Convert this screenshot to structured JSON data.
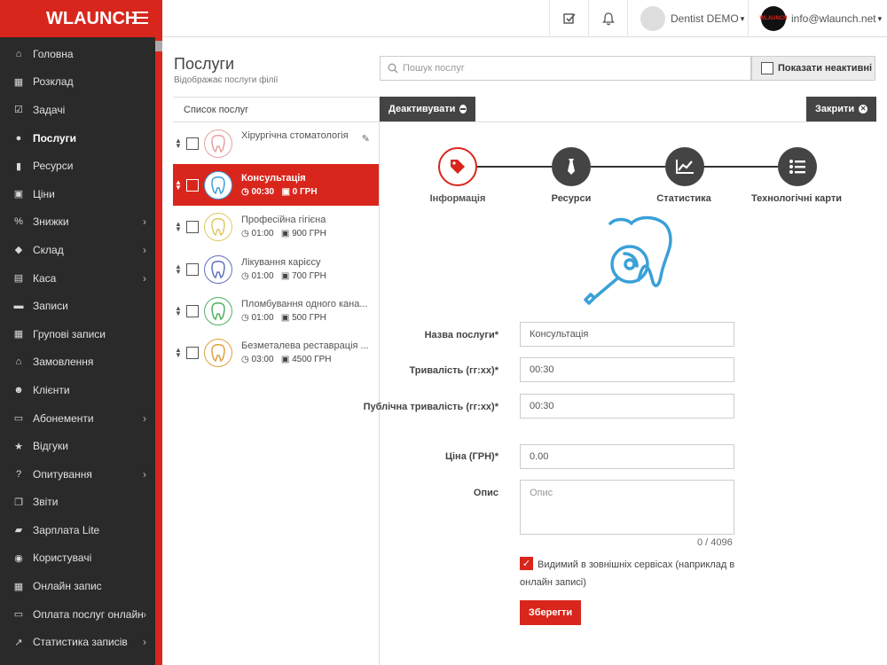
{
  "app": {
    "logo_w": "W",
    "logo_rest": "LAUNCH"
  },
  "sidebar": {
    "items": [
      {
        "label": "Головна",
        "icon": "home-icon",
        "glyph": "⌂",
        "arrow": false
      },
      {
        "label": "Розклад",
        "icon": "calendar-icon",
        "glyph": "▦",
        "arrow": false
      },
      {
        "label": "Задачі",
        "icon": "checkbox-icon",
        "glyph": "☑",
        "arrow": false
      },
      {
        "label": "Послуги",
        "icon": "tag-icon",
        "glyph": "●",
        "arrow": false,
        "active": true
      },
      {
        "label": "Ресурси",
        "icon": "resource-icon",
        "glyph": "▮",
        "arrow": false
      },
      {
        "label": "Ціни",
        "icon": "money-icon",
        "glyph": "▣",
        "arrow": false
      },
      {
        "label": "Знижки",
        "icon": "percent-icon",
        "glyph": "%",
        "arrow": true
      },
      {
        "label": "Склад",
        "icon": "cubes-icon",
        "glyph": "◆",
        "arrow": true
      },
      {
        "label": "Каса",
        "icon": "calculator-icon",
        "glyph": "▤",
        "arrow": true
      },
      {
        "label": "Записи",
        "icon": "list-icon",
        "glyph": "▬",
        "arrow": false
      },
      {
        "label": "Групові записи",
        "icon": "calendar-plus-icon",
        "glyph": "▦",
        "arrow": false
      },
      {
        "label": "Замовлення",
        "icon": "bank-icon",
        "glyph": "⌂",
        "arrow": false
      },
      {
        "label": "Клієнти",
        "icon": "users-icon",
        "glyph": "☻",
        "arrow": false
      },
      {
        "label": "Абонементи",
        "icon": "id-card-icon",
        "glyph": "▭",
        "arrow": true
      },
      {
        "label": "Відгуки",
        "icon": "star-icon",
        "glyph": "★",
        "arrow": false
      },
      {
        "label": "Опитування",
        "icon": "question-icon",
        "glyph": "?",
        "arrow": true
      },
      {
        "label": "Звіти",
        "icon": "copy-icon",
        "glyph": "❐",
        "arrow": false
      },
      {
        "label": "Зарплата Lite",
        "icon": "book-icon",
        "glyph": "▰",
        "arrow": false
      },
      {
        "label": "Користувачі",
        "icon": "user-circle-icon",
        "glyph": "◉",
        "arrow": false
      },
      {
        "label": "Онлайн запис",
        "icon": "calendar-check-icon",
        "glyph": "▦",
        "arrow": false
      },
      {
        "label": "Оплата послуг онлайн",
        "icon": "credit-card-icon",
        "glyph": "▭",
        "arrow": true
      },
      {
        "label": "Статистика записів",
        "icon": "line-chart-icon",
        "glyph": "↗",
        "arrow": true
      }
    ]
  },
  "topbar": {
    "user1": "Dentist DEMO",
    "user2": "info@wlaunch.net",
    "avatar2_text": "WLAUNCH"
  },
  "page": {
    "title": "Послуги",
    "subtitle": "Відображає послуги філії",
    "search_placeholder": "Пошук послуг",
    "show_inactive": "Показати неактивні"
  },
  "list": {
    "header": "Список послуг",
    "items": [
      {
        "name": "Хірургічна стоматологія",
        "time": "",
        "price": "",
        "active": false
      },
      {
        "name": "Консультація",
        "time": "00:30",
        "price": "0 ГРН",
        "active": true
      },
      {
        "name": "Професійна гігієна",
        "time": "01:00",
        "price": "900 ГРН",
        "active": false
      },
      {
        "name": "Лікування карієсу",
        "time": "01:00",
        "price": "700 ГРН",
        "active": false
      },
      {
        "name": "Пломбування одного кана...",
        "time": "01:00",
        "price": "500 ГРН",
        "active": false
      },
      {
        "name": "Безметалева реставрація ...",
        "time": "03:00",
        "price": "4500 ГРН",
        "active": false
      }
    ]
  },
  "panel": {
    "deactivate": "Деактивувати",
    "close": "Закрити",
    "steps": [
      "Інформація",
      "Ресурси",
      "Статистика",
      "Технологічні карти"
    ],
    "form": {
      "name_label": "Назва послуги*",
      "name_value": "Консультація",
      "duration_label": "Тривалість (гг:хх)*",
      "duration_value": "00:30",
      "public_duration_label": "Публічна тривалість (гг:хх)*",
      "public_duration_value": "00:30",
      "price_label": "Ціна (ГРН)*",
      "price_value": "0.00",
      "desc_label": "Опис",
      "desc_placeholder": "Опис",
      "counter": "0 / 4096",
      "visible_label": "Видимий в зовнішніх сервісах (наприклад в онлайн записі)",
      "save": "Зберегти"
    }
  },
  "colors": {
    "brand": "#d9261c",
    "sidebar": "#2a2a2a",
    "dark_button": "#444444",
    "icon_blue": "#3aa0d8"
  }
}
